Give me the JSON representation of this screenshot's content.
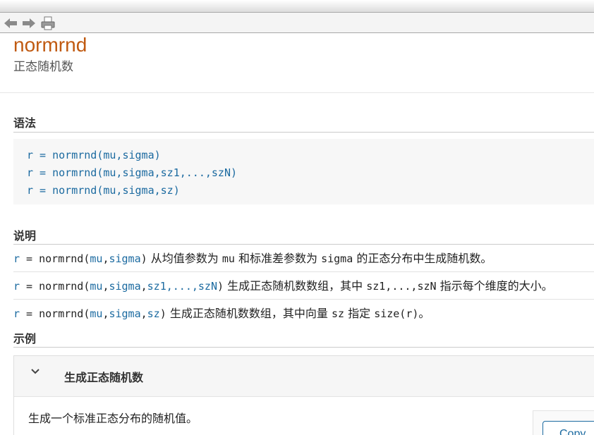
{
  "page": {
    "title": "normrnd",
    "subtitle": "正态随机数"
  },
  "sections": {
    "syntax": "语法",
    "description": "说明",
    "examples": "示例"
  },
  "syntax_lines": [
    "r = normrnd(mu,sigma)",
    "r = normrnd(mu,sigma,sz1,...,szN)",
    "r = normrnd(mu,sigma,sz)"
  ],
  "descriptions": [
    {
      "r": "r",
      "eq": " = normrnd(",
      "a1": "mu",
      "c1": ",",
      "a2": "sigma",
      "close": ")",
      "t1": " 从均值参数为 ",
      "m1": "mu",
      "t2": " 和标准差参数为 ",
      "m2": "sigma",
      "t3": " 的正态分布中生成随机数。"
    },
    {
      "r": "r",
      "eq": " = normrnd(",
      "a1": "mu",
      "c1": ",",
      "a2": "sigma",
      "c2": ",",
      "a3": "sz1,...,szN",
      "close": ")",
      "t1": " 生成正态随机数数组，其中 ",
      "m1": "sz1,...,szN",
      "t2": " 指示每个维度的大小。"
    },
    {
      "r": "r",
      "eq": " = normrnd(",
      "a1": "mu",
      "c1": ",",
      "a2": "sigma",
      "c2": ",",
      "a3": "sz",
      "close": ")",
      "t1": " 生成正态随机数数组，其中向量 ",
      "m1": "sz",
      "t2": " 指定 ",
      "m2": "size(r)",
      "t3": "。"
    }
  ],
  "example": {
    "title": "生成正态随机数",
    "text": "生成一个标准正态分布的随机值。",
    "copy_label": "Copy"
  },
  "icons": {
    "back": "back-arrow-icon",
    "forward": "forward-arrow-icon",
    "print": "print-icon",
    "expand": "chevron-down-icon"
  },
  "colors": {
    "title": "#c05a11",
    "code": "#1b6aa0"
  }
}
